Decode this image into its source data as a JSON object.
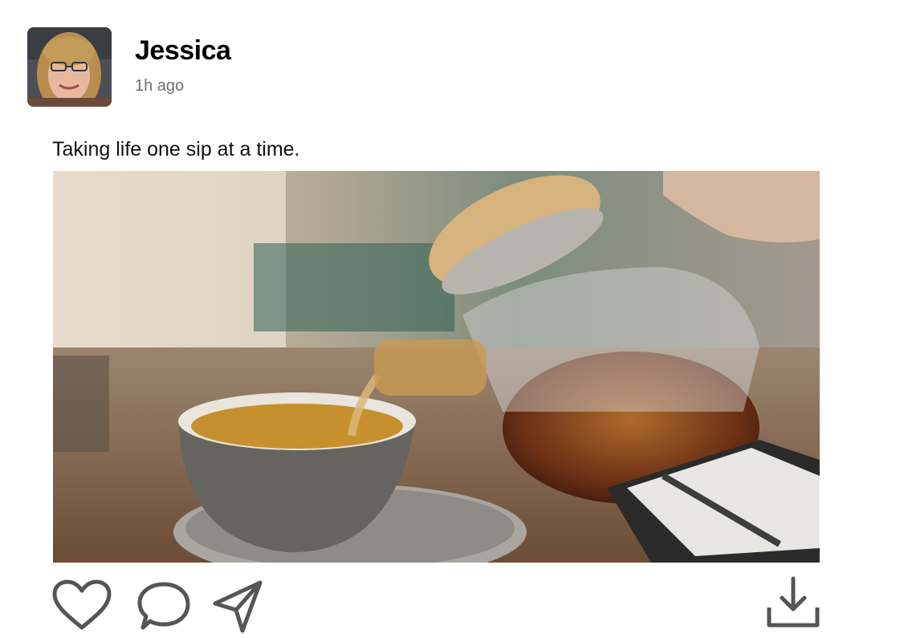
{
  "post": {
    "author": "Jessica",
    "time": "1h ago",
    "caption": "Taking life one sip at a time.",
    "avatar_icon": "profile-photo",
    "image_description_icon": "tea-pouring-photo"
  },
  "actions": {
    "like_icon": "heart-icon",
    "comment_icon": "comment-bubble-icon",
    "share_icon": "send-icon",
    "download_icon": "download-icon"
  },
  "colors": {
    "icon_stroke": "#555555",
    "time_text": "#6f6f6f"
  }
}
